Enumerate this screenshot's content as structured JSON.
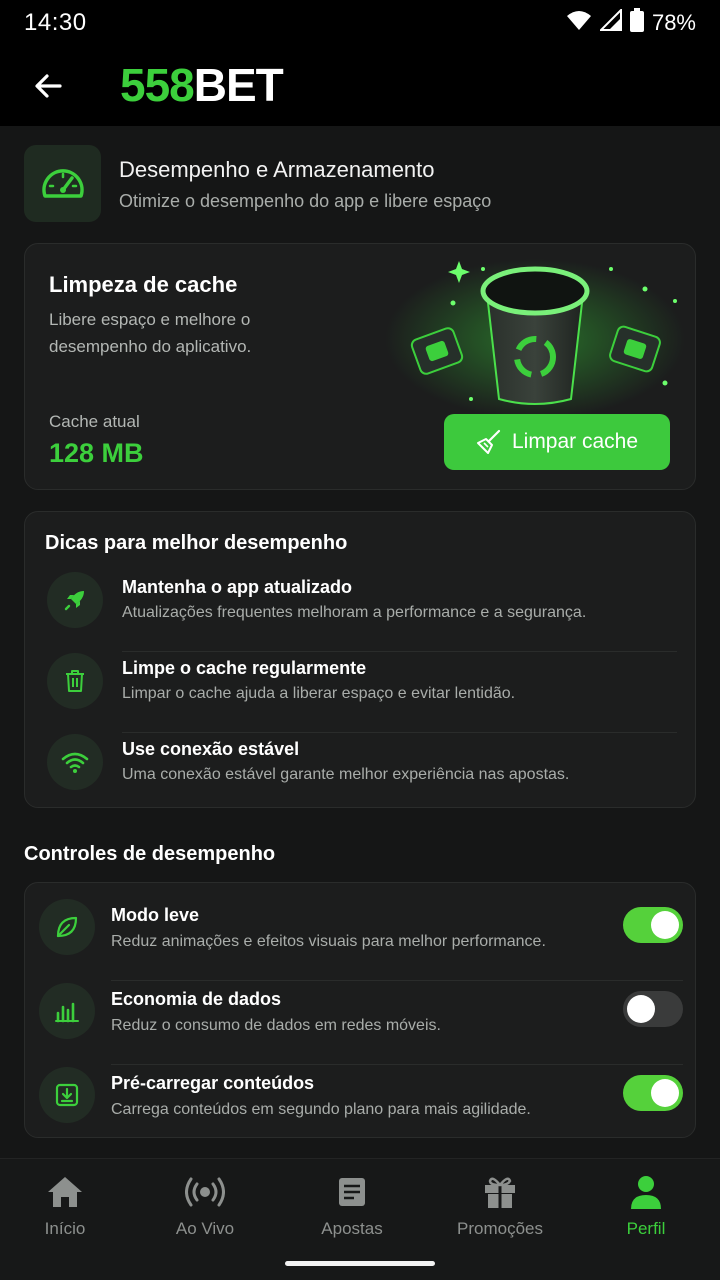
{
  "status_bar": {
    "time": "14:30",
    "battery": "78%"
  },
  "header": {
    "logo_number": "558",
    "logo_text": "BET",
    "back_icon": "arrow-left-icon"
  },
  "section": {
    "icon": "speedometer-icon",
    "title": "Desempenho e Armazenamento",
    "subtitle": "Otimize o desempenho do app e libere espaço"
  },
  "cache": {
    "title": "Limpeza de cache",
    "description": "Libere espaço e melhore o desempenho do aplicativo.",
    "current_label": "Cache atual",
    "current_value": "128 MB",
    "button_label": "Limpar cache",
    "button_icon": "broom-icon"
  },
  "tips": {
    "title": "Dicas para melhor desempenho",
    "items": [
      {
        "icon": "rocket-icon",
        "title": "Mantenha o app atualizado",
        "description": "Atualizações frequentes melhoram a performance e a segurança."
      },
      {
        "icon": "trash-icon",
        "title": "Limpe o cache regularmente",
        "description": "Limpar o cache ajuda a liberar espaço e evitar lentidão."
      },
      {
        "icon": "wifi-icon",
        "title": "Use conexão estável",
        "description": "Uma conexão estável garante melhor experiência nas apostas."
      }
    ]
  },
  "controls": {
    "title": "Controles de desempenho",
    "items": [
      {
        "icon": "leaf-icon",
        "title": "Modo leve",
        "description": "Reduz animações e efeitos visuais para melhor performance.",
        "enabled": true
      },
      {
        "icon": "data-chart-icon",
        "title": "Economia de dados",
        "description": "Reduz o consumo de dados em redes móveis.",
        "enabled": false
      },
      {
        "icon": "download-icon",
        "title": "Pré-carregar conteúdos",
        "description": "Carrega conteúdos em segundo plano para mais agilidade.",
        "enabled": true
      }
    ]
  },
  "nav": {
    "items": [
      {
        "icon": "home-icon",
        "label": "Início"
      },
      {
        "icon": "live-icon",
        "label": "Ao Vivo"
      },
      {
        "icon": "ticket-icon",
        "label": "Apostas"
      },
      {
        "icon": "gift-icon",
        "label": "Promoções"
      },
      {
        "icon": "user-icon",
        "label": "Perfil",
        "active": true
      }
    ]
  },
  "colors": {
    "accent": "#3ccf3c",
    "background": "#151616",
    "card": "#1c1d1d"
  }
}
